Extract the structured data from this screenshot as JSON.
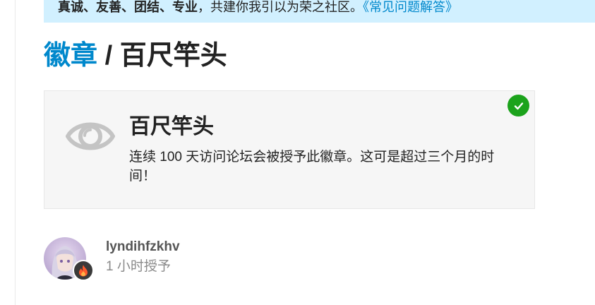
{
  "notice": {
    "bold_values": "真诚、友善、团结、专业",
    "text": "，共建你我引以为荣之社区。",
    "link": "《常见问题解答》"
  },
  "page": {
    "breadcrumb": "徽章",
    "separator": " / ",
    "badge_title": "百尺竿头"
  },
  "badge": {
    "name": "百尺竿头",
    "description": "连续 100 天访问论坛会被授予此徽章。这可是超过三个月的时间！",
    "icon": "eye-icon",
    "status_icon": "check-icon",
    "status_color": "#1ca31c"
  },
  "grant": {
    "username": "lyndihfzkhv",
    "time": "1 小时授予",
    "flair_icon": "fire-icon"
  },
  "colors": {
    "link": "#0088cc",
    "notice_bg": "#d1f0ff",
    "card_bg": "#f6f6f6"
  }
}
